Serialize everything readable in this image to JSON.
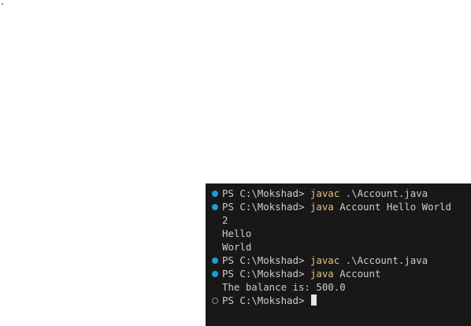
{
  "terminal": {
    "lines": [
      {
        "type": "command",
        "status": "success",
        "prompt": "PS C:\\Mokshad> ",
        "command": "javac",
        "args": " .\\Account.java"
      },
      {
        "type": "command",
        "status": "success",
        "prompt": "PS C:\\Mokshad> ",
        "command": "java",
        "args": " Account Hello World"
      },
      {
        "type": "output",
        "text": "2"
      },
      {
        "type": "output",
        "text": "Hello"
      },
      {
        "type": "output",
        "text": "World"
      },
      {
        "type": "command",
        "status": "success",
        "prompt": "PS C:\\Mokshad> ",
        "command": "javac",
        "args": " .\\Account.java"
      },
      {
        "type": "command",
        "status": "success",
        "prompt": "PS C:\\Mokshad> ",
        "command": "java",
        "args": " Account"
      },
      {
        "type": "output",
        "text": "The balance is: 500.0"
      },
      {
        "type": "prompt",
        "status": "pending",
        "prompt": "PS C:\\Mokshad> "
      }
    ]
  },
  "colors": {
    "terminal_background": "#181818",
    "terminal_text": "#cccccc",
    "command_highlight": "#e5c07b",
    "success_decoration": "#1f9bd6",
    "pending_decoration": "#8a8a8a"
  }
}
